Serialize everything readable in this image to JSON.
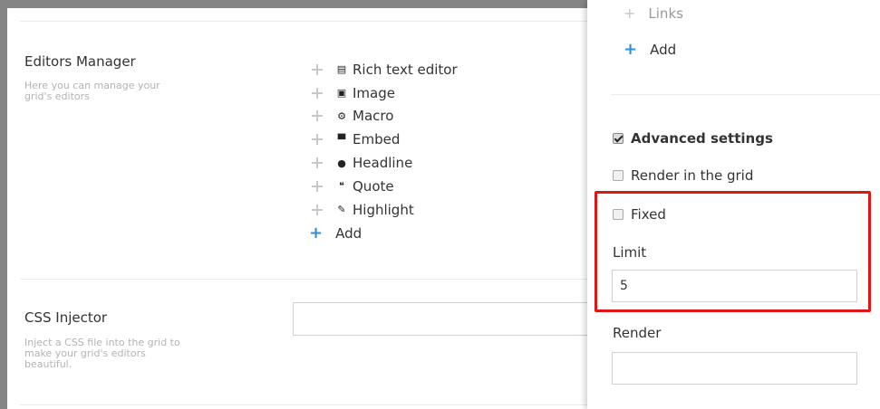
{
  "editors_manager": {
    "title": "Editors Manager",
    "description_lines": [
      "Here you can manage your",
      "grid's editors"
    ],
    "editors": [
      {
        "label": "Rich text editor",
        "icon": "rich-text-icon",
        "glyph": "▤"
      },
      {
        "label": "Image",
        "icon": "image-icon",
        "glyph": "▣"
      },
      {
        "label": "Macro",
        "icon": "macro-icon",
        "glyph": "⚙"
      },
      {
        "label": "Embed",
        "icon": "embed-icon",
        "glyph": "▀"
      },
      {
        "label": "Headline",
        "icon": "headline-icon",
        "glyph": "●"
      },
      {
        "label": "Quote",
        "icon": "quote-icon",
        "glyph": "❝"
      },
      {
        "label": "Highlight",
        "icon": "highlight-icon",
        "glyph": "✎"
      }
    ],
    "add_label": "Add"
  },
  "css_injector": {
    "title": "CSS Injector",
    "description_lines": [
      "Inject a CSS file into the grid to",
      "make your grid's editors",
      "beautiful."
    ],
    "value": ""
  },
  "panel": {
    "links_label": "Links",
    "add_label": "Add",
    "advanced_settings_label": "Advanced settings",
    "advanced_settings_checked": true,
    "render_in_grid_label": "Render in the grid",
    "render_in_grid_checked": false,
    "fixed_label": "Fixed",
    "fixed_checked": false,
    "limit_label": "Limit",
    "limit_value": "5",
    "render_label": "Render",
    "render_value": ""
  },
  "colors": {
    "accent_plus": "#2b8fe0",
    "highlight_border": "#e01515",
    "frame": "#858585"
  }
}
